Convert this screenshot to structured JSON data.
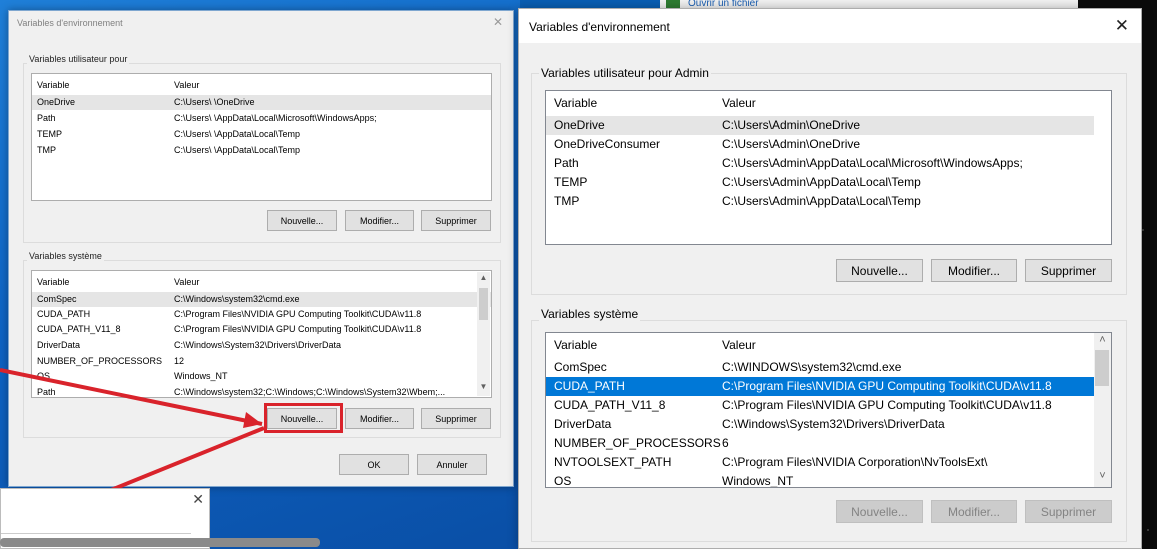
{
  "background": {
    "open_files_link": "Ouvrir un fichier"
  },
  "old_dialog": {
    "title": "Variables d'environnement",
    "user_group_label": "Variables utilisateur pour",
    "user_headers": [
      "Variable",
      "Valeur"
    ],
    "user_rows": [
      {
        "name": "OneDrive",
        "value": "C:\\Users\\          \\OneDrive"
      },
      {
        "name": "Path",
        "value": "C:\\Users\\          \\AppData\\Local\\Microsoft\\WindowsApps;"
      },
      {
        "name": "TEMP",
        "value": "C:\\Users\\          \\AppData\\Local\\Temp"
      },
      {
        "name": "TMP",
        "value": "C:\\Users\\          \\AppData\\Local\\Temp"
      }
    ],
    "system_group_label": "Variables système",
    "system_headers": [
      "Variable",
      "Valeur"
    ],
    "system_rows": [
      {
        "name": "ComSpec",
        "value": "C:\\Windows\\system32\\cmd.exe"
      },
      {
        "name": "CUDA_PATH",
        "value": "C:\\Program Files\\NVIDIA GPU Computing Toolkit\\CUDA\\v11.8"
      },
      {
        "name": "CUDA_PATH_V11_8",
        "value": "C:\\Program Files\\NVIDIA GPU Computing Toolkit\\CUDA\\v11.8"
      },
      {
        "name": "DriverData",
        "value": "C:\\Windows\\System32\\Drivers\\DriverData"
      },
      {
        "name": "NUMBER_OF_PROCESSORS",
        "value": "12"
      },
      {
        "name": "OS",
        "value": "Windows_NT"
      },
      {
        "name": "Path",
        "value": "C:\\Windows\\system32;C:\\Windows;C:\\Windows\\System32\\Wbem;..."
      }
    ],
    "buttons": {
      "new": "Nouvelle...",
      "edit": "Modifier...",
      "delete": "Supprimer",
      "ok": "OK",
      "cancel": "Annuler"
    }
  },
  "main_dialog": {
    "title": "Variables d'environnement",
    "user_group_label": "Variables utilisateur pour Admin",
    "user_headers": [
      "Variable",
      "Valeur"
    ],
    "user_rows": [
      {
        "name": "OneDrive",
        "value": "C:\\Users\\Admin\\OneDrive"
      },
      {
        "name": "OneDriveConsumer",
        "value": "C:\\Users\\Admin\\OneDrive"
      },
      {
        "name": "Path",
        "value": "C:\\Users\\Admin\\AppData\\Local\\Microsoft\\WindowsApps;"
      },
      {
        "name": "TEMP",
        "value": "C:\\Users\\Admin\\AppData\\Local\\Temp"
      },
      {
        "name": "TMP",
        "value": "C:\\Users\\Admin\\AppData\\Local\\Temp"
      }
    ],
    "user_buttons": {
      "new": "Nouvelle...",
      "edit": "Modifier...",
      "delete": "Supprimer"
    },
    "system_group_label": "Variables système",
    "system_headers": [
      "Variable",
      "Valeur"
    ],
    "system_rows": [
      {
        "name": "ComSpec",
        "value": "C:\\WINDOWS\\system32\\cmd.exe"
      },
      {
        "name": "CUDA_PATH",
        "value": "C:\\Program Files\\NVIDIA GPU Computing Toolkit\\CUDA\\v11.8"
      },
      {
        "name": "CUDA_PATH_V11_8",
        "value": "C:\\Program Files\\NVIDIA GPU Computing Toolkit\\CUDA\\v11.8"
      },
      {
        "name": "DriverData",
        "value": "C:\\Windows\\System32\\Drivers\\DriverData"
      },
      {
        "name": "NUMBER_OF_PROCESSORS",
        "value": "6"
      },
      {
        "name": "NVTOOLSEXT_PATH",
        "value": "C:\\Program Files\\NVIDIA Corporation\\NvToolsExt\\"
      },
      {
        "name": "OS",
        "value": "Windows_NT"
      }
    ],
    "system_buttons": {
      "new": "Nouvelle...",
      "edit": "Modifier...",
      "delete": "Supprimer"
    }
  },
  "colors": {
    "selection": "#0078d7",
    "annotation_red": "#d9232b"
  }
}
